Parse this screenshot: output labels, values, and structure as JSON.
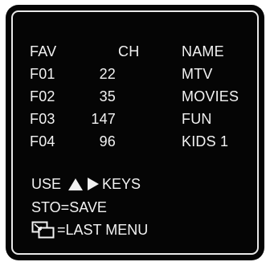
{
  "header": {
    "fav": "FAV",
    "ch": "CH",
    "name": "NAME"
  },
  "favorites": [
    {
      "fav": "F01",
      "ch": "22",
      "name": "MTV"
    },
    {
      "fav": "F02",
      "ch": "35",
      "name": "MOVIES"
    },
    {
      "fav": "F03",
      "ch": "147",
      "name": "FUN"
    },
    {
      "fav": "F04",
      "ch": "96",
      "name": "KIDS 1"
    }
  ],
  "footer": {
    "use_label": "USE",
    "up_icon": "up-arrow-icon",
    "right_icon": "right-arrow-icon",
    "keys_label": "KEYS",
    "sto_save": "STO=SAVE",
    "menu_icon": "menu-icon",
    "last_menu": "=LAST MENU"
  },
  "colors": {
    "screen_bg": "#050505",
    "text": "#f2f2f2",
    "border": "#e9e9e9"
  }
}
